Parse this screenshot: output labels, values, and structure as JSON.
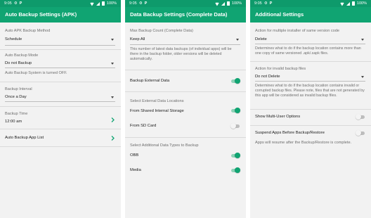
{
  "colors": {
    "accent": "#10a472",
    "statusbar": "#0e9a6b",
    "panel_bg": "#f2f2f2"
  },
  "status": {
    "time": "9:05",
    "battery": "100%",
    "left_icons": [
      "settings-icon",
      "p-icon"
    ]
  },
  "panels": [
    {
      "title": "Auto Backup Settings (APK)",
      "auto_backup_method": {
        "label": "Auto APK Backup Method",
        "value": "Schedule"
      },
      "auto_backup_mode": {
        "label": "Auto Backup Mode",
        "value": "Do not Backup",
        "note": "Auto Backup System is turned OFF."
      },
      "backup_interval": {
        "label": "Backup Interval",
        "value": "Once a Day"
      },
      "backup_time": {
        "label": "Backup Time",
        "value": "12:00 am"
      },
      "app_list": {
        "label": "Auto Backup App List"
      }
    },
    {
      "title": "Data Backup Settings (Complete Data)",
      "max_count": {
        "label": "Max Backup Count (Complete Data)",
        "value": "Keep All",
        "desc": "This number of latest data backups (of individual apps) will be there in the backup folder, older versions will be deleted automatically."
      },
      "external": {
        "label": "Backup External Data",
        "on": true
      },
      "locations_header": "Select External Data Locations",
      "shared_storage": {
        "label": "From Shared Internal Storage",
        "on": true
      },
      "sd_card": {
        "label": "From SD Card",
        "on": false
      },
      "types_header": "Select Additional Data Types to Backup",
      "obb": {
        "label": "OBB",
        "on": true
      },
      "media": {
        "label": "Media",
        "on": true
      }
    },
    {
      "title": "Additional Settings",
      "multiple_installer": {
        "label": "Action for multiple installer of same version code",
        "value": "Delete",
        "desc": "Determines what to do if the backup location contains more than one copy of same versioned .apk/.sapk files."
      },
      "invalid_files": {
        "label": "Action for invalid backup files",
        "value": "Do not Delete",
        "desc": "Determines what to do if the backup location contains invalid or corrupted backup files. Please note, files that are not generated by this app will be considered as invalid backup files."
      },
      "multi_user": {
        "label": "Show Multi-User Options",
        "on": false
      },
      "suspend_apps": {
        "label": "Suspend Apps Before Backup/Restore",
        "on": false,
        "desc": "Apps will resume after the Backup/Restore is complete."
      }
    }
  ]
}
